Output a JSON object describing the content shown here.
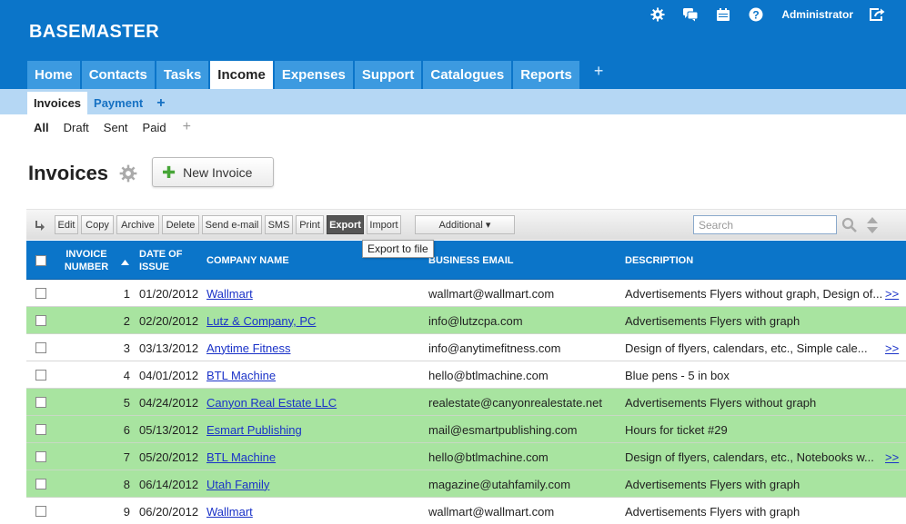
{
  "app": {
    "brand": "BASEMASTER",
    "user": "Administrator",
    "icons": [
      "gear-icon",
      "chat-icon",
      "calendar-icon",
      "help-icon",
      "logout-icon"
    ]
  },
  "main_tabs": [
    {
      "label": "Home",
      "active": false
    },
    {
      "label": "Contacts",
      "active": false
    },
    {
      "label": "Tasks",
      "active": false
    },
    {
      "label": "Income",
      "active": true
    },
    {
      "label": "Expenses",
      "active": false
    },
    {
      "label": "Support",
      "active": false
    },
    {
      "label": "Catalogues",
      "active": false
    },
    {
      "label": "Reports",
      "active": false
    }
  ],
  "main_tab_add": "+",
  "sub_tabs": [
    {
      "label": "Invoices",
      "active": true
    },
    {
      "label": "Payment",
      "active": false
    }
  ],
  "sub_tab_add": "+",
  "filters": [
    {
      "label": "All",
      "active": true
    },
    {
      "label": "Draft",
      "active": false
    },
    {
      "label": "Sent",
      "active": false
    },
    {
      "label": "Paid",
      "active": false
    }
  ],
  "filter_add": "+",
  "page": {
    "title": "Invoices",
    "new_button": "New Invoice"
  },
  "toolbar": {
    "buttons": [
      "Edit",
      "Copy",
      "Archive",
      "Delete",
      "Send e-mail",
      "SMS",
      "Print",
      "Export",
      "Import"
    ],
    "highlighted": "Export",
    "additional": "Additional ▾",
    "search_placeholder": "Search",
    "tooltip": "Export to file"
  },
  "table": {
    "headers": {
      "number_line1": "INVOICE",
      "number_line2": "NUMBER",
      "date_line1": "DATE OF",
      "date_line2": "ISSUE",
      "company": "COMPANY NAME",
      "email": "BUSINESS EMAIL",
      "description": "DESCRIPTION"
    },
    "more_label": ">>",
    "rows": [
      {
        "number": "1",
        "date": "01/20/2012",
        "company": "Wallmart",
        "email": "wallmart@wallmart.com",
        "description": "Advertisements Flyers without graph, Design of...",
        "more": true,
        "highlight": false
      },
      {
        "number": "2",
        "date": "02/20/2012",
        "company": "Lutz & Company, PC",
        "email": "info@lutzcpa.com",
        "description": "Advertisements Flyers with graph",
        "more": false,
        "highlight": true
      },
      {
        "number": "3",
        "date": "03/13/2012",
        "company": "Anytime Fitness",
        "email": "info@anytimefitness.com",
        "description": "Design of flyers, calendars, etc., Simple cale...",
        "more": true,
        "highlight": false
      },
      {
        "number": "4",
        "date": "04/01/2012",
        "company": "BTL Machine",
        "email": "hello@btlmachine.com",
        "description": "Blue pens - 5 in box",
        "more": false,
        "highlight": false
      },
      {
        "number": "5",
        "date": "04/24/2012",
        "company": "Canyon Real Estate LLC",
        "email": "realestate@canyonrealestate.net",
        "description": "Advertisements Flyers without graph",
        "more": false,
        "highlight": true
      },
      {
        "number": "6",
        "date": "05/13/2012",
        "company": "Esmart Publishing",
        "email": "mail@esmartpublishing.com",
        "description": "Hours for ticket #29",
        "more": false,
        "highlight": true
      },
      {
        "number": "7",
        "date": "05/20/2012",
        "company": "BTL Machine",
        "email": "hello@btlmachine.com",
        "description": "Design of flyers, calendars, etc., Notebooks w...",
        "more": true,
        "highlight": true
      },
      {
        "number": "8",
        "date": "06/14/2012",
        "company": "Utah Family",
        "email": "magazine@utahfamily.com",
        "description": "Advertisements Flyers with graph",
        "more": false,
        "highlight": true
      },
      {
        "number": "9",
        "date": "06/20/2012",
        "company": "Wallmart",
        "email": "wallmart@wallmart.com",
        "description": "Advertisements Flyers with graph",
        "more": false,
        "highlight": false
      }
    ]
  }
}
